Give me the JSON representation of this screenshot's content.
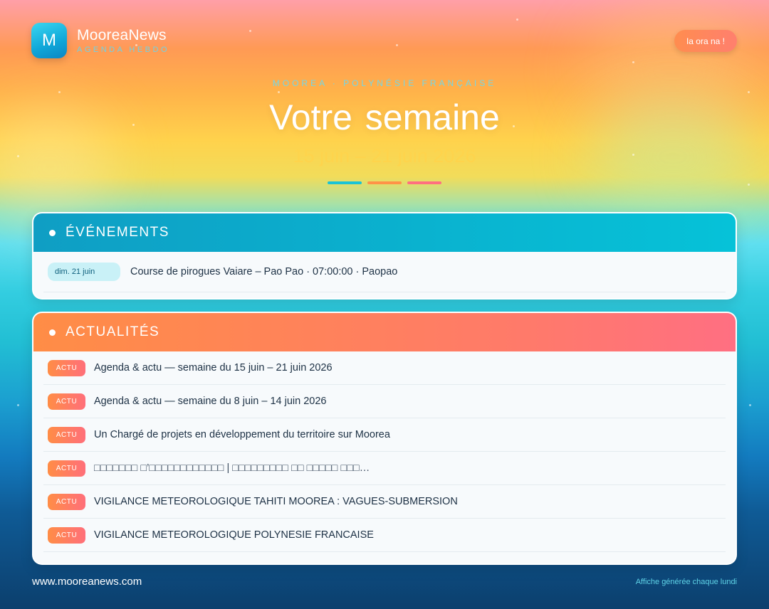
{
  "brand": {
    "logo_letter": "M",
    "name": "MooreaNews",
    "tagline": "AGENDA HEBDO"
  },
  "greeting": "Ia ora na !",
  "hero": {
    "kicker": "MOOREA · POLYNÉSIE FRANÇAISE",
    "title": "Votre semaine",
    "dates": "15 juin – 21 juin 2026"
  },
  "colors": {
    "accent_teal": "#19c3d6",
    "accent_orange": "#ff9248",
    "accent_pink": "#ff6f80",
    "news_badge": "#ff8d46",
    "date_pill": "#c9f1f7",
    "text_dark": "#1d3145"
  },
  "events": {
    "header": "ÉVÉNEMENTS",
    "items": [
      {
        "date": "dim. 21 juin",
        "text": "Course de pirogues Vaiare – Pao Pao · 07:00:00 · Paopao"
      }
    ]
  },
  "news": {
    "header": "ACTUALITÉS",
    "badge": "ACTU",
    "items": [
      {
        "text": "Agenda & actu — semaine du 15 juin – 21 juin 2026"
      },
      {
        "text": "Agenda & actu — semaine du 8 juin – 14 juin 2026"
      },
      {
        "text": "Un Chargé de projets en développement du territoire sur Moorea"
      },
      {
        "text": "□□□□□□□ □’□□□□□□□□□□□□ | □□□□□□□□□ □□ □□□□□ □□□…"
      },
      {
        "text": "VIGILANCE METEOROLOGIQUE TAHITI MOOREA : VAGUES-SUBMERSION"
      },
      {
        "text": "VIGILANCE METEOROLOGIQUE POLYNESIE FRANCAISE"
      }
    ]
  },
  "footer": {
    "website": "www.mooreanews.com",
    "note": "Affiche générée chaque lundi"
  }
}
